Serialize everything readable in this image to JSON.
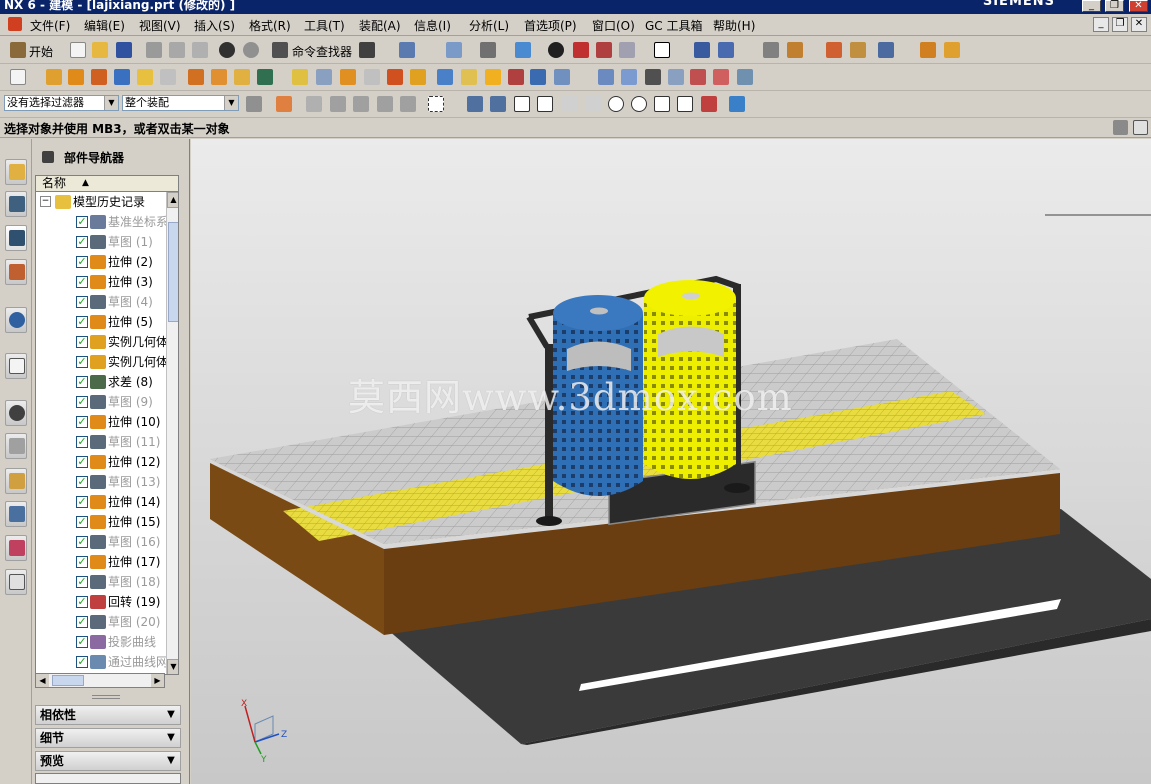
{
  "window": {
    "title": "NX 6 - 建模 - [lajixiang.prt  (修改的) ]",
    "brand": "SIEMENS",
    "controls": [
      "_",
      "❐",
      "✕"
    ]
  },
  "menu": {
    "items": [
      "文件(F)",
      "编辑(E)",
      "视图(V)",
      "插入(S)",
      "格式(R)",
      "工具(T)",
      "装配(A)",
      "信息(I)",
      "分析(L)",
      "首选项(P)",
      "窗口(O)",
      "GC 工具箱",
      "帮助(H)"
    ]
  },
  "toolbar": {
    "start_label": "开始",
    "command_finder_label": "命令查找器",
    "selection_filter": "没有选择过滤器",
    "selection_scope": "整个装配"
  },
  "cue": {
    "text": "选择对象并使用 MB3，或者双击某一对象"
  },
  "navigator": {
    "title": "部件导航器",
    "column_name": "名称",
    "root": "模型历史记录",
    "features": [
      {
        "label": "基准坐标系",
        "icon": "datum-csys-icon",
        "color": "#6a7a9a",
        "suppressed": true
      },
      {
        "label": "草图 (1)",
        "icon": "sketch-icon",
        "color": "#5a6a7a",
        "suppressed": true
      },
      {
        "label": "拉伸 (2)",
        "icon": "extrude-icon",
        "color": "#e08a1a",
        "suppressed": false
      },
      {
        "label": "拉伸 (3)",
        "icon": "extrude-icon",
        "color": "#e08a1a",
        "suppressed": false
      },
      {
        "label": "草图 (4)",
        "icon": "sketch-icon",
        "color": "#5a6a7a",
        "suppressed": true
      },
      {
        "label": "拉伸 (5)",
        "icon": "extrude-icon",
        "color": "#e08a1a",
        "suppressed": false
      },
      {
        "label": "实例几何体",
        "icon": "instance-geometry-icon",
        "color": "#e0a020",
        "suppressed": false
      },
      {
        "label": "实例几何体",
        "icon": "instance-geometry-icon",
        "color": "#e0a020",
        "suppressed": false
      },
      {
        "label": "求差 (8)",
        "icon": "subtract-icon",
        "color": "#4a6a4a",
        "suppressed": false
      },
      {
        "label": "草图 (9)",
        "icon": "sketch-icon",
        "color": "#5a6a7a",
        "suppressed": true
      },
      {
        "label": "拉伸 (10)",
        "icon": "extrude-icon",
        "color": "#e08a1a",
        "suppressed": false
      },
      {
        "label": "草图 (11)",
        "icon": "sketch-icon",
        "color": "#5a6a7a",
        "suppressed": true
      },
      {
        "label": "拉伸 (12)",
        "icon": "extrude-icon",
        "color": "#e08a1a",
        "suppressed": false
      },
      {
        "label": "草图 (13)",
        "icon": "sketch-icon",
        "color": "#5a6a7a",
        "suppressed": true
      },
      {
        "label": "拉伸 (14)",
        "icon": "extrude-icon",
        "color": "#e08a1a",
        "suppressed": false
      },
      {
        "label": "拉伸 (15)",
        "icon": "extrude-icon",
        "color": "#e08a1a",
        "suppressed": false
      },
      {
        "label": "草图 (16)",
        "icon": "sketch-icon",
        "color": "#5a6a7a",
        "suppressed": true
      },
      {
        "label": "拉伸 (17)",
        "icon": "extrude-icon",
        "color": "#e08a1a",
        "suppressed": false
      },
      {
        "label": "草图 (18)",
        "icon": "sketch-icon",
        "color": "#5a6a7a",
        "suppressed": true
      },
      {
        "label": "回转 (19)",
        "icon": "revolve-icon",
        "color": "#c04040",
        "suppressed": false
      },
      {
        "label": "草图 (20)",
        "icon": "sketch-icon",
        "color": "#5a6a7a",
        "suppressed": true
      },
      {
        "label": "投影曲线",
        "icon": "projected-curve-icon",
        "color": "#8a6aa0",
        "suppressed": true
      },
      {
        "label": "通过曲线网格",
        "icon": "through-curves-icon",
        "color": "#6a8ab0",
        "suppressed": true
      }
    ],
    "sections": [
      "相依性",
      "细节",
      "预览"
    ]
  },
  "viewport": {
    "watermark": "莫西网www.3dmox.com",
    "triad_labels": {
      "x": "X",
      "y": "Y",
      "z": "Z"
    },
    "colors": {
      "blue_bin": "#2f6fb5",
      "yellow_bin": "#f2f200",
      "paving": "#c8c8c8",
      "tactile_strip": "#e6dc3c",
      "soil": "#7a4a1a",
      "road": "#3c3c3c",
      "lane_mark": "#ffffff"
    }
  }
}
